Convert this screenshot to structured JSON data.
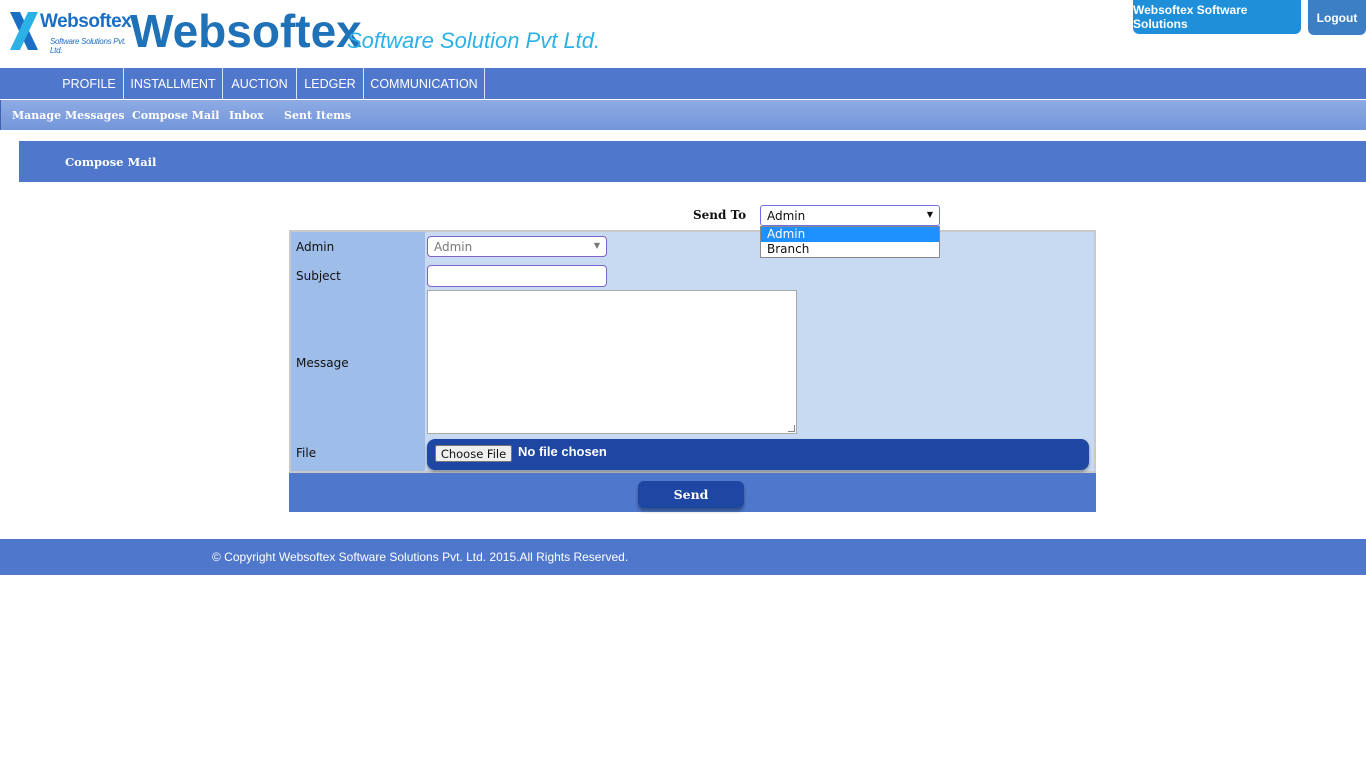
{
  "header": {
    "logo_small_name": "Websoftex",
    "logo_small_sub": "Software Solutions Pvt. Ltd.",
    "logo_big": "Websoftex",
    "logo_tagline": "Software Solution Pvt Ltd.",
    "company_button": "Websoftex Software Solutions",
    "logout_button": "Logout"
  },
  "main_nav": {
    "items": [
      {
        "label": "PROFILE"
      },
      {
        "label": "INSTALLMENT"
      },
      {
        "label": "AUCTION"
      },
      {
        "label": "LEDGER"
      },
      {
        "label": "COMMUNICATION"
      }
    ]
  },
  "sub_nav": {
    "items": [
      {
        "label": "Manage Messages",
        "active": true
      },
      {
        "label": "Compose Mail"
      },
      {
        "label": "Inbox"
      },
      {
        "label": "Sent Items"
      }
    ]
  },
  "page_title": "Compose Mail",
  "send_to": {
    "label": "Send To",
    "selected": "Admin",
    "options": [
      "Admin",
      "Branch"
    ],
    "highlighted": "Admin"
  },
  "form": {
    "admin_label": "Admin",
    "admin_select_value": "Admin",
    "subject_label": "Subject",
    "subject_value": "",
    "message_label": "Message",
    "message_value": "",
    "file_label": "File",
    "choose_file_button": "Choose File",
    "file_status": "No file chosen"
  },
  "send_button": "Send",
  "footer": {
    "copyright": "© Copyright Websoftex Software Solutions Pvt. Ltd. 2015.All Rights Reserved."
  },
  "colors": {
    "nav_blue": "#4f78cc",
    "dark_blue": "#1e47a3",
    "label_column": "#9fbde9",
    "form_background": "#c8daf1",
    "highlight": "#1e90ff"
  }
}
